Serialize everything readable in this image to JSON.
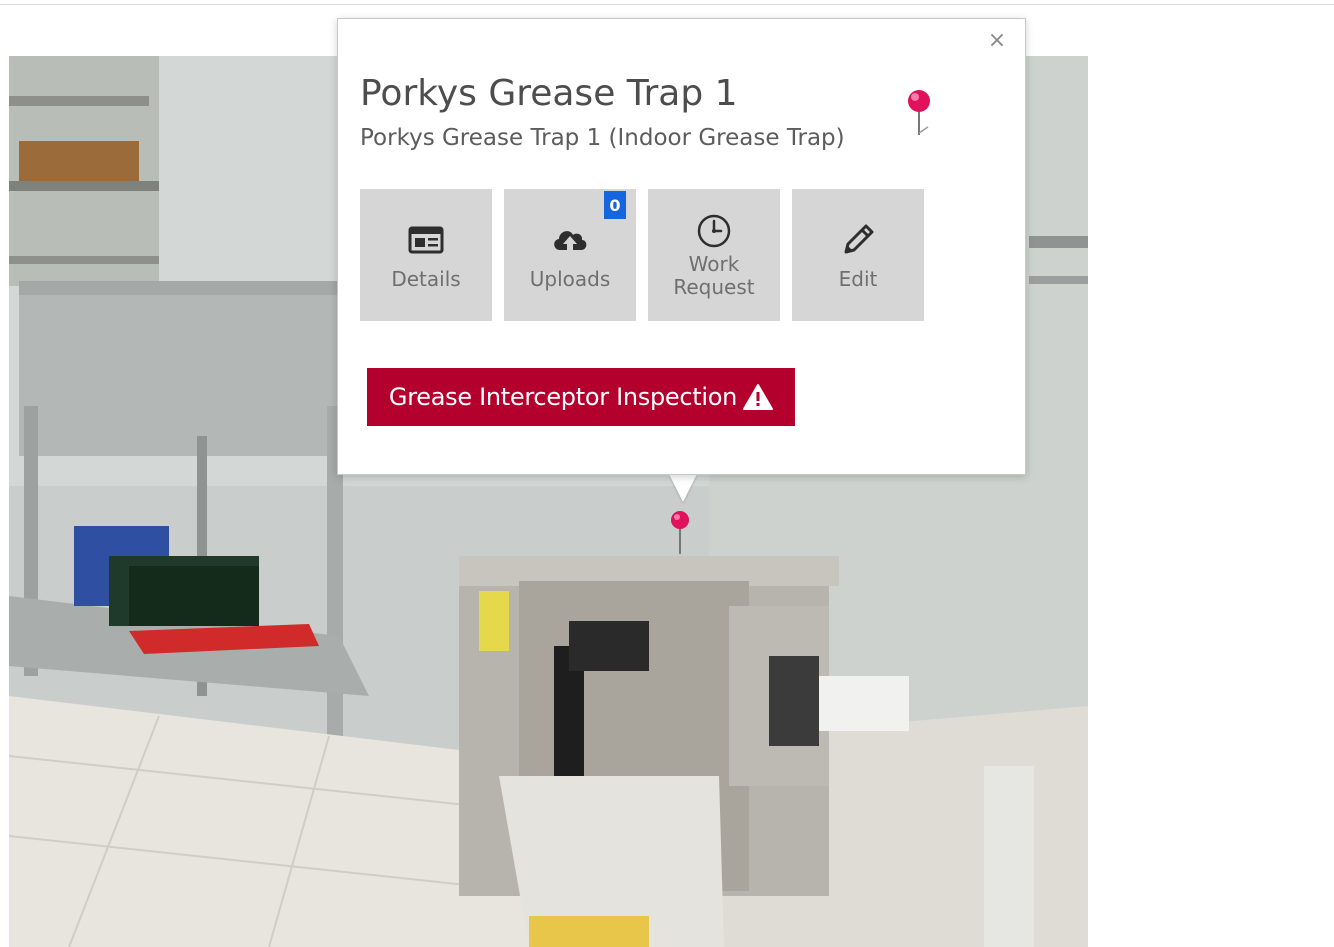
{
  "popup": {
    "title": "Porkys Grease Trap 1",
    "subtitle": "Porkys Grease Trap 1 (Indoor Grease Trap)",
    "close_label": "×",
    "pin_color": "#e0125b",
    "actions": [
      {
        "label": "Details",
        "icon": "details-icon"
      },
      {
        "label": "Uploads",
        "icon": "cloud-upload-icon",
        "badge": "0"
      },
      {
        "label": "Work\nRequest",
        "icon": "clock-icon"
      },
      {
        "label": "Edit",
        "icon": "pencil-icon"
      }
    ],
    "inspection_button": {
      "label": "Grease Interceptor Inspection",
      "icon": "warning-icon",
      "color": "#b3002d"
    }
  },
  "colors": {
    "tile_bg": "#d6d6d6",
    "badge_bg": "#1565e0"
  }
}
